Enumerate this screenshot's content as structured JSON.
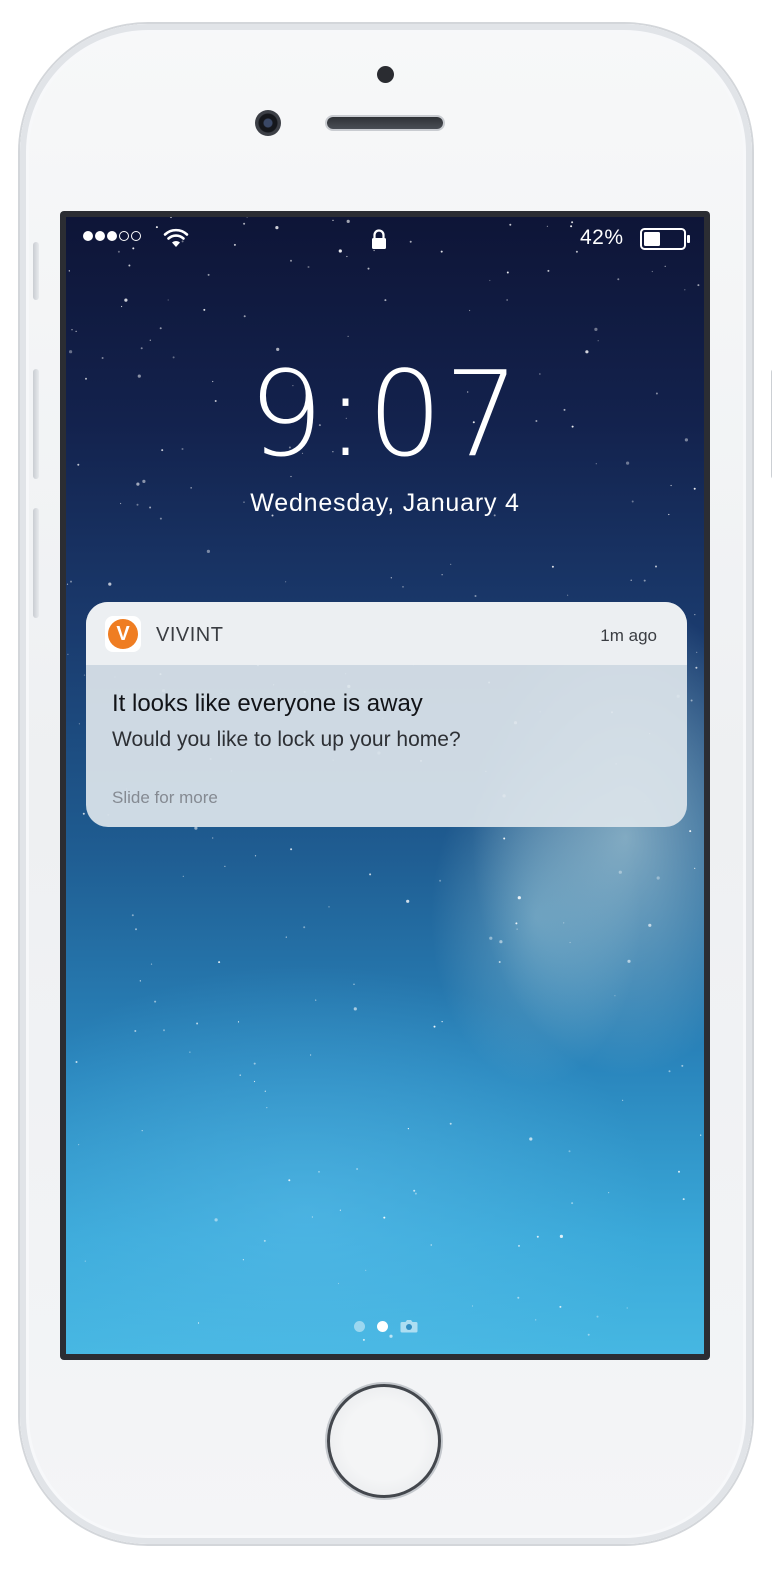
{
  "status_bar": {
    "signal": {
      "filled_dots": 3,
      "total_dots": 5
    },
    "wifi_icon": "wifi-icon",
    "lock_icon": "lock-icon",
    "battery_percent": "42%",
    "battery_level": 0.42
  },
  "lock_screen": {
    "time": "9:07",
    "date": "Wednesday, January 4"
  },
  "notification": {
    "app_icon_letter": "V",
    "app_name": "VIVINT",
    "time_ago": "1m ago",
    "title": "It looks like everyone is away",
    "body": "Would you like to lock up your home?",
    "hint": "Slide for more",
    "brand_color": "#ef7d22"
  },
  "page_indicator": {
    "pages": 2,
    "active_index": 1,
    "trailing_icon": "camera-icon"
  }
}
